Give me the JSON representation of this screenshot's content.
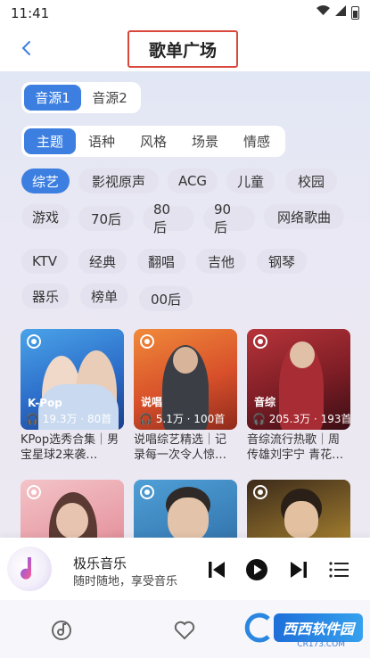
{
  "status_bar": {
    "time": "11:41"
  },
  "header": {
    "title": "歌单广场"
  },
  "source_tabs": [
    {
      "label": "音源1",
      "active": true
    },
    {
      "label": "音源2",
      "active": false
    }
  ],
  "category_tabs": [
    {
      "label": "主题",
      "active": true
    },
    {
      "label": "语种",
      "active": false
    },
    {
      "label": "风格",
      "active": false
    },
    {
      "label": "场景",
      "active": false
    },
    {
      "label": "情感",
      "active": false
    }
  ],
  "tags": [
    {
      "label": "综艺",
      "active": true
    },
    {
      "label": "影视原声"
    },
    {
      "label": "ACG"
    },
    {
      "label": "儿童"
    },
    {
      "label": "校园"
    },
    {
      "label": "游戏"
    },
    {
      "label": "70后"
    },
    {
      "label": "80后"
    },
    {
      "label": "90后"
    },
    {
      "label": "网络歌曲"
    },
    {
      "label": "KTV"
    },
    {
      "label": "经典"
    },
    {
      "label": "翻唱"
    },
    {
      "label": "吉他"
    },
    {
      "label": "钢琴"
    },
    {
      "label": "器乐"
    },
    {
      "label": "榜单"
    },
    {
      "label": "00后"
    }
  ],
  "playlists": [
    {
      "tag": "K-Pop",
      "stats": "19.3万 · 80首",
      "title": "KPop选秀合集｜男宝星球2来袭…"
    },
    {
      "tag": "说唱",
      "stats": "5.1万 · 100首",
      "title": "说唱综艺精选｜记录每一次令人惊…"
    },
    {
      "tag": "音综",
      "stats": "205.3万 · 193首",
      "title": "音综流行热歌｜周传雄刘宇宁 青花…"
    },
    {
      "tag": "",
      "stats": "",
      "title": ""
    },
    {
      "tag": "",
      "stats": "",
      "title": ""
    },
    {
      "tag": "",
      "stats": "",
      "title": ""
    }
  ],
  "player": {
    "name": "极乐音乐",
    "subtitle": "随时随地，享受音乐"
  },
  "watermark": {
    "main": "西西软件园",
    "sub": "CR173.COM"
  },
  "colors": {
    "accent": "#3d7fe0",
    "highlight_border": "#d9473b"
  }
}
